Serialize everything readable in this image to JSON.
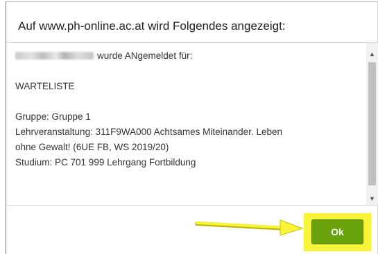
{
  "dialog": {
    "title": "Auf www.ph-online.ac.at wird Folgendes angezeigt:",
    "message": {
      "registered_suffix": "wurde ANgemeldet für:",
      "status": "WARTELISTE",
      "group": "Gruppe: Gruppe 1",
      "course_line_1": "Lehrveranstaltung: 311F9WA000 Achtsames Miteinander. Leben",
      "course_line_2": "ohne Gewalt! (6UE FB, WS 2019/20)",
      "study": "Studium: PC 701 999 Lehrgang Fortbildung"
    },
    "ok_label": "Ok"
  },
  "colors": {
    "ok_button": "#6aa20c",
    "highlight": "#f7f43a",
    "annotation_arrow": "#f7f43a"
  },
  "icons": {
    "scroll_up": "chevron-up-icon",
    "scroll_down": "chevron-down-icon",
    "annotation": "arrow-right-icon"
  }
}
